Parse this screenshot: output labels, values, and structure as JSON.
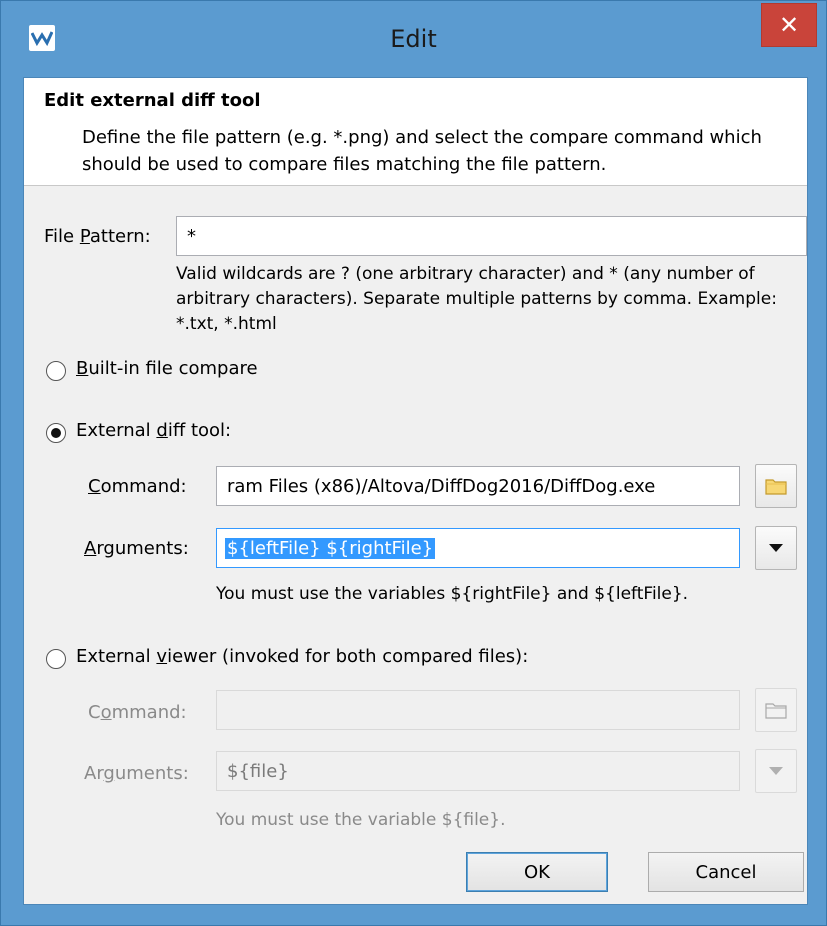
{
  "window": {
    "title": "Edit",
    "close_glyph": "✕"
  },
  "header": {
    "title": "Edit external diff tool",
    "description": "Define the file pattern (e.g. *.png) and select the compare command which should be used to compare files matching the file pattern."
  },
  "file_pattern": {
    "label_prefix": "File ",
    "label_mnemonic": "P",
    "label_suffix": "attern:",
    "value": "*",
    "help": "Valid wildcards are ? (one arbitrary character) and * (any number of arbitrary characters). Separate multiple patterns by comma. Example: *.txt, *.html"
  },
  "builtin": {
    "mnemonic": "B",
    "label_rest": "uilt-in file compare",
    "checked": false
  },
  "external_diff": {
    "label_prefix": "External ",
    "mnemonic": "d",
    "label_suffix": "iff tool:",
    "checked": true,
    "command_mnemonic": "C",
    "command_rest": "ommand:",
    "command_value": "ram Files (x86)/Altova/DiffDog2016/DiffDog.exe",
    "arguments_mnemonic": "A",
    "arguments_rest": "rguments:",
    "arguments_value": "${leftFile} ${rightFile}",
    "help": "You must use the variables ${rightFile} and ${leftFile}."
  },
  "external_viewer": {
    "label_prefix": "External ",
    "mnemonic": "v",
    "label_suffix": "iewer (invoked for both compared files):",
    "checked": false,
    "command_prefix": "C",
    "command_mnemonic": "o",
    "command_rest": "mmand:",
    "command_value": "",
    "arguments_prefix": "Ar",
    "arguments_mnemonic": "g",
    "arguments_rest": "uments:",
    "arguments_value": "${file}",
    "help": "You must use the variable ${file}."
  },
  "buttons": {
    "ok": "OK",
    "cancel": "Cancel"
  },
  "colors": {
    "titlebar": "#5b9bd0",
    "close": "#c9443a",
    "selection": "#3399ff"
  }
}
